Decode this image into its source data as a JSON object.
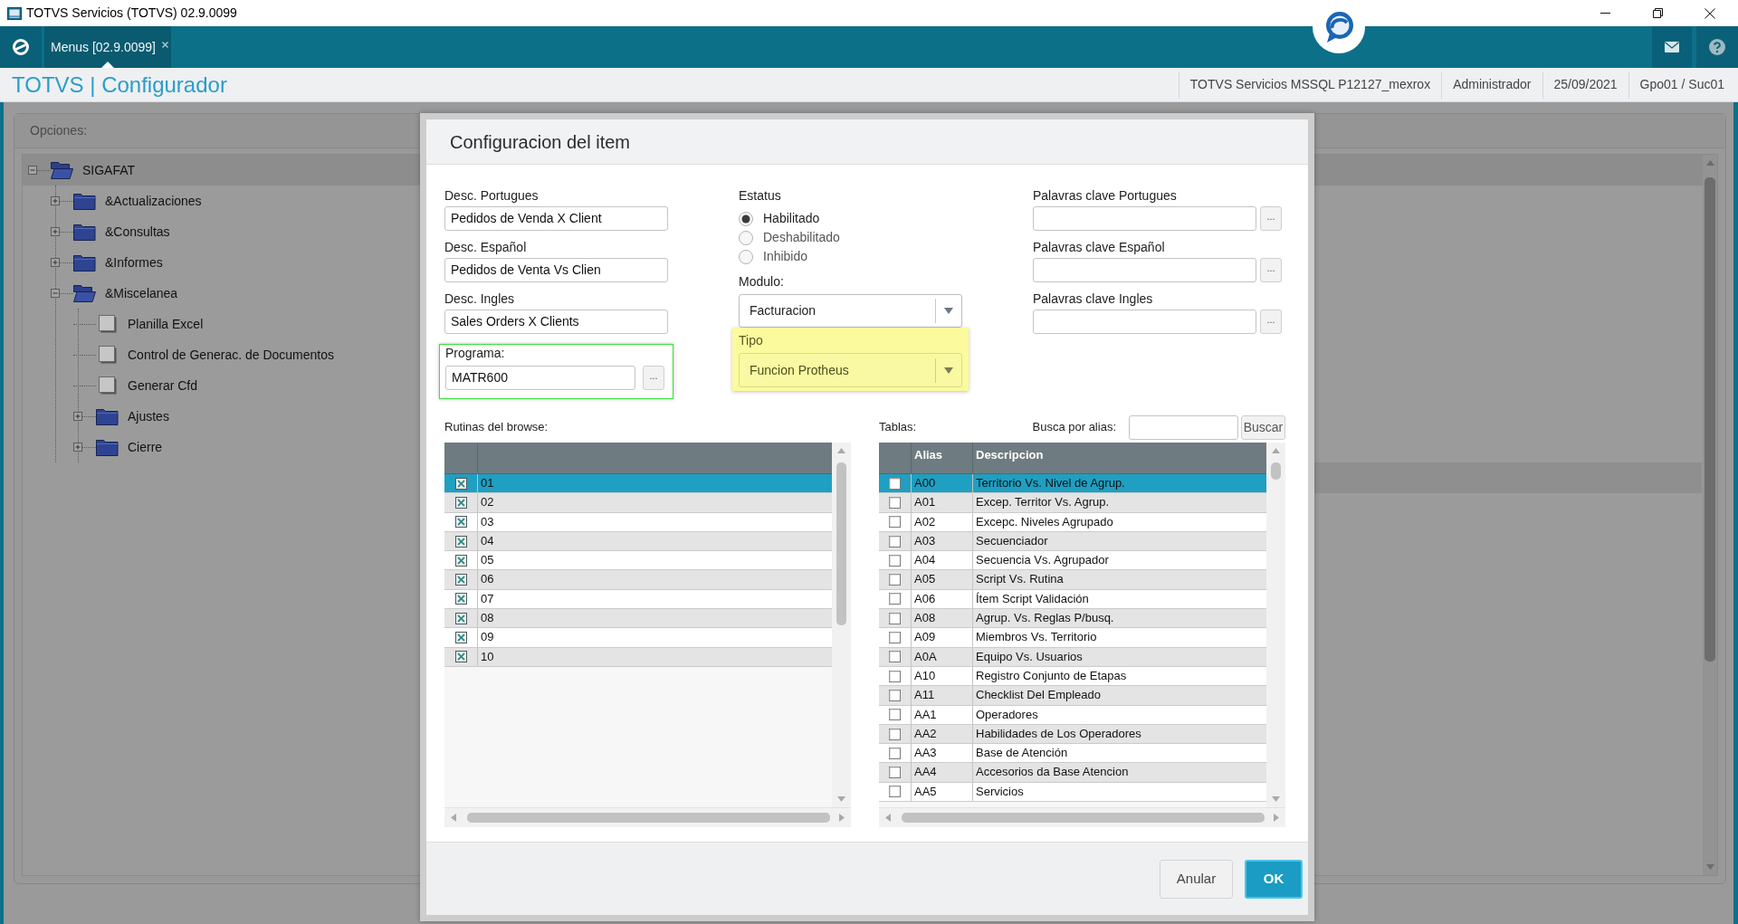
{
  "window": {
    "title": "TOTVS Servicios (TOTVS) 02.9.0099"
  },
  "tabs": [
    {
      "label": "Menus [02.9.0099]",
      "selected": true
    }
  ],
  "header": {
    "title": "TOTVS | Configurador",
    "info": [
      "TOTVS Servicios MSSQL P12127_mexrox",
      "Administrador",
      "25/09/2021",
      "Gpo01 / Suc01"
    ]
  },
  "options": {
    "label": "Opciones:",
    "tree": [
      {
        "label": "SIGAFAT",
        "kind": "folder",
        "expanded": true,
        "selected": true,
        "children": [
          {
            "label": "&Actualizaciones",
            "kind": "folder",
            "expanded": false,
            "selected": false
          },
          {
            "label": "&Consultas",
            "kind": "folder",
            "expanded": false,
            "selected": false
          },
          {
            "label": "&Informes",
            "kind": "folder",
            "expanded": false,
            "selected": false
          },
          {
            "label": "&Miscelanea",
            "kind": "folder",
            "expanded": true,
            "selected": false,
            "children": [
              {
                "label": "Planilla Excel",
                "kind": "item",
                "selected": false
              },
              {
                "label": "Control de Generac. de Documentos",
                "kind": "item",
                "selected": false
              },
              {
                "label": "Generar Cfd",
                "kind": "item",
                "selected": false
              },
              {
                "label": "Ajustes",
                "kind": "folder",
                "expanded": false,
                "selected": false
              },
              {
                "label": "Cierre",
                "kind": "folder",
                "expanded": false,
                "selected": false
              }
            ]
          }
        ]
      }
    ]
  },
  "dialog": {
    "title": "Configuracion del item",
    "descriptions": [
      {
        "label": "Desc. Portugues",
        "value": "Pedidos de Venda X Client"
      },
      {
        "label": "Desc. Español",
        "value": "Pedidos de Venta Vs Clien"
      },
      {
        "label": "Desc. Ingles",
        "value": "Sales Orders X Clients"
      }
    ],
    "programa": {
      "label": "Programa:",
      "value": "MATR600",
      "button": "...",
      "highlighted": true
    },
    "status": {
      "label": "Estatus",
      "options": [
        {
          "label": "Habilitado",
          "selected": true
        },
        {
          "label": "Deshabilitado",
          "selected": false
        },
        {
          "label": "Inhibido",
          "selected": false
        }
      ]
    },
    "modulo": {
      "label": "Modulo:",
      "value": "Facturacion"
    },
    "tipo": {
      "label": "Tipo",
      "value": "Funcion Protheus",
      "highlighted": true
    },
    "keywords": [
      {
        "label": "Palavras clave Portugues",
        "button": "..."
      },
      {
        "label": "Palavras clave Español",
        "button": "..."
      },
      {
        "label": "Palavras clave Ingles",
        "button": "..."
      }
    ],
    "routines": {
      "label": "Rutinas del browse:",
      "rows": [
        {
          "value": "01",
          "checked": true,
          "selected": true
        },
        {
          "value": "02",
          "checked": true,
          "selected": false
        },
        {
          "value": "03",
          "checked": true,
          "selected": false
        },
        {
          "value": "04",
          "checked": true,
          "selected": false
        },
        {
          "value": "05",
          "checked": true,
          "selected": false
        },
        {
          "value": "06",
          "checked": true,
          "selected": false
        },
        {
          "value": "07",
          "checked": true,
          "selected": false
        },
        {
          "value": "08",
          "checked": true,
          "selected": false
        },
        {
          "value": "09",
          "checked": true,
          "selected": false
        },
        {
          "value": "10",
          "checked": true,
          "selected": false
        }
      ]
    },
    "tables": {
      "label": "Tablas:",
      "search_label": "Busca por alias:",
      "search_button": "Buscar",
      "columns": [
        "Alias",
        "Descripcion"
      ],
      "rows": [
        {
          "alias": "A00",
          "description": "Territorio Vs. Nivel de Agrup.",
          "checked": false,
          "selected": true
        },
        {
          "alias": "A01",
          "description": "Excep. Territor Vs. Agrup.",
          "checked": false,
          "selected": false
        },
        {
          "alias": "A02",
          "description": "Excepc. Niveles Agrupado",
          "checked": false,
          "selected": false
        },
        {
          "alias": "A03",
          "description": "Secuenciador",
          "checked": false,
          "selected": false
        },
        {
          "alias": "A04",
          "description": "Secuencia Vs. Agrupador",
          "checked": false,
          "selected": false
        },
        {
          "alias": "A05",
          "description": "Script Vs. Rutina",
          "checked": false,
          "selected": false
        },
        {
          "alias": "A06",
          "description": "Ítem Script Validación",
          "checked": false,
          "selected": false
        },
        {
          "alias": "A08",
          "description": "Agrup. Vs. Reglas P/busq.",
          "checked": false,
          "selected": false
        },
        {
          "alias": "A09",
          "description": "Miembros Vs. Territorio",
          "checked": false,
          "selected": false
        },
        {
          "alias": "A0A",
          "description": "Equipo Vs. Usuarios",
          "checked": false,
          "selected": false
        },
        {
          "alias": "A10",
          "description": "Registro Conjunto de Etapas",
          "checked": false,
          "selected": false
        },
        {
          "alias": "A11",
          "description": "Checklist Del Empleado",
          "checked": false,
          "selected": false
        },
        {
          "alias": "AA1",
          "description": "Operadores",
          "checked": false,
          "selected": false
        },
        {
          "alias": "AA2",
          "description": "Habilidades de Los Operadores",
          "checked": false,
          "selected": false
        },
        {
          "alias": "AA3",
          "description": "Base de Atención",
          "checked": false,
          "selected": false
        },
        {
          "alias": "AA4",
          "description": "Accesorios da Base Atencion",
          "checked": false,
          "selected": false
        },
        {
          "alias": "AA5",
          "description": "Servicios",
          "checked": false,
          "selected": false
        }
      ]
    },
    "buttons": [
      {
        "label": "Anular",
        "kind": "secondary"
      },
      {
        "label": "OK",
        "kind": "primary"
      }
    ]
  }
}
